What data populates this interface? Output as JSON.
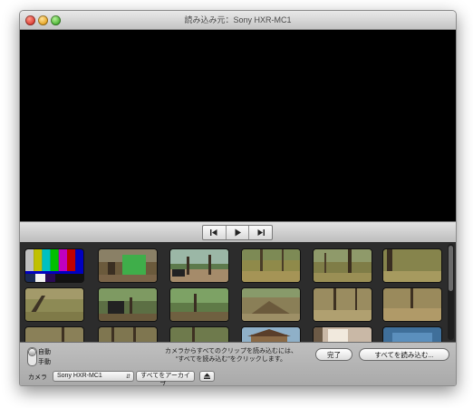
{
  "window": {
    "title": "読み込み元：Sony HXR-MC1"
  },
  "transport": {
    "prev_icon": "skip-back-icon",
    "play_icon": "play-icon",
    "next_icon": "skip-forward-icon"
  },
  "mode": {
    "auto_label": "自動",
    "manual_label": "手動"
  },
  "hint": {
    "line1": "カメラからすべてのクリップを読み込むには、",
    "line2": "“すべてを読み込む”をクリックします。"
  },
  "buttons": {
    "done": "完了",
    "import_all": "すべてを読み込む..."
  },
  "footer": {
    "camera_label": "カメラ",
    "camera_select": "Sony HXR-MC1",
    "archive_all": "すべてをアーカイブ...",
    "eject_icon": "eject-icon"
  },
  "colors": {
    "viewer": "#000000",
    "browser": "#2c2c2c",
    "chrome": "#cfcfcf"
  }
}
